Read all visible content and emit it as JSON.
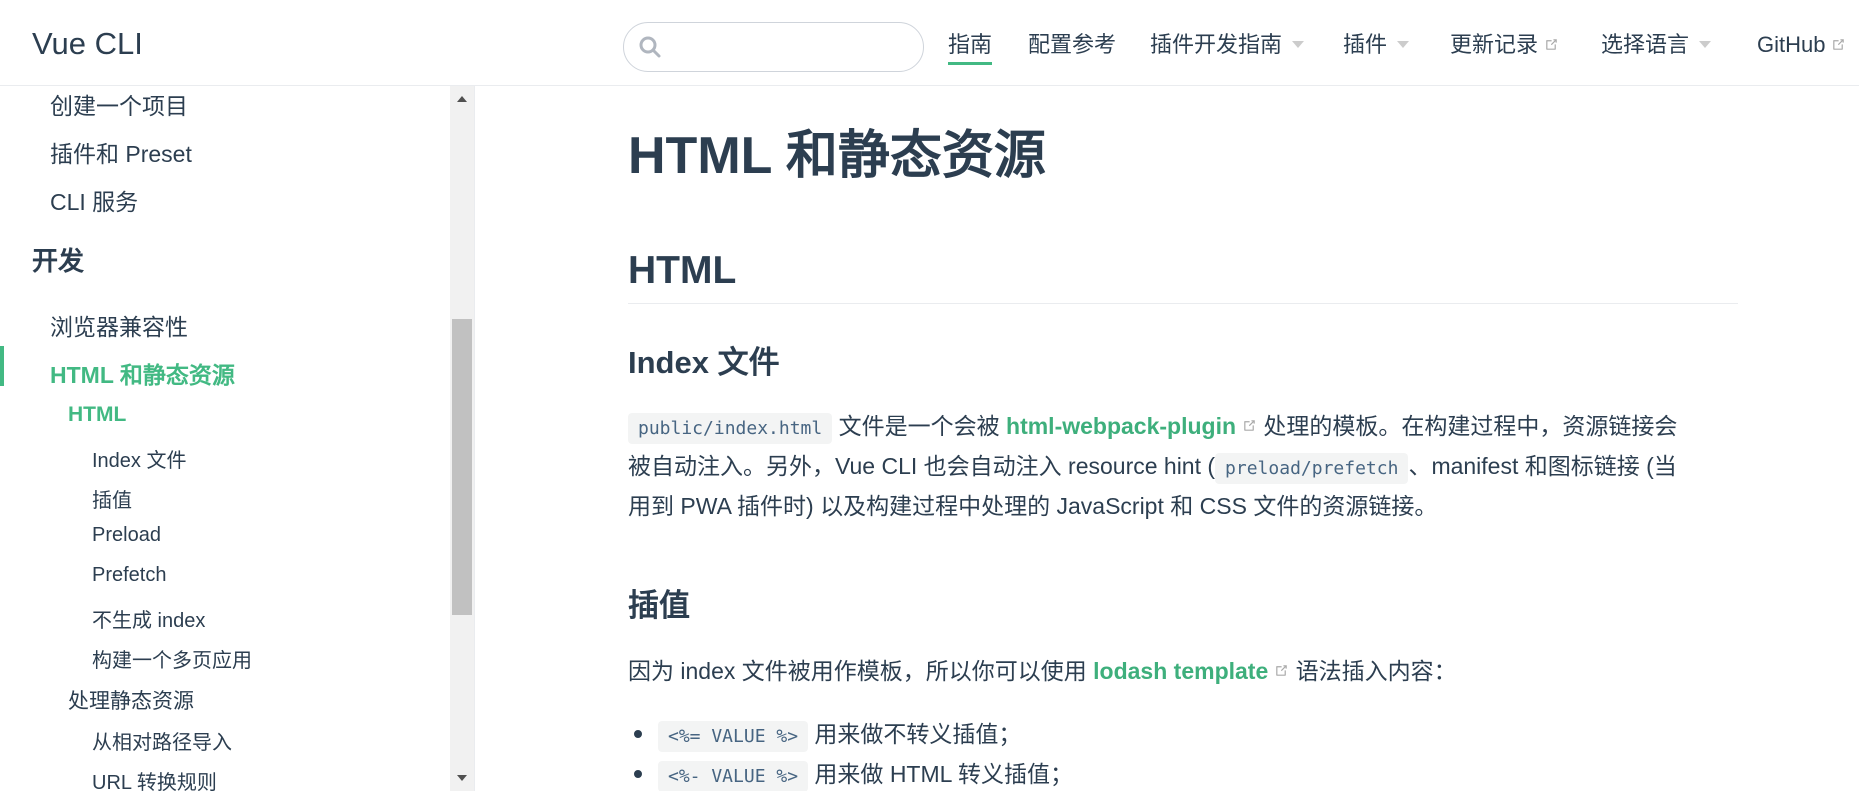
{
  "header": {
    "site_name": "Vue CLI",
    "search": {
      "placeholder": ""
    },
    "nav": [
      {
        "label": "指南",
        "active": true,
        "dropdown": false,
        "external": false
      },
      {
        "label": "配置参考",
        "active": false,
        "dropdown": false,
        "external": false
      },
      {
        "label": "插件开发指南",
        "active": false,
        "dropdown": true,
        "external": false
      },
      {
        "label": "插件",
        "active": false,
        "dropdown": true,
        "external": false
      },
      {
        "label": "更新记录",
        "active": false,
        "dropdown": false,
        "external": true
      },
      {
        "label": "选择语言",
        "active": false,
        "dropdown": true,
        "external": false
      },
      {
        "label": "GitHub",
        "active": false,
        "dropdown": false,
        "external": true
      }
    ]
  },
  "sidebar": {
    "items": [
      {
        "label": "创建一个项目",
        "level": 1
      },
      {
        "label": "插件和 Preset",
        "level": 1
      },
      {
        "label": "CLI 服务",
        "level": 1
      },
      {
        "label": "开发",
        "level": 0
      },
      {
        "label": "浏览器兼容性",
        "level": 1
      },
      {
        "label": "HTML 和静态资源",
        "level": 1,
        "active": true
      },
      {
        "label": "HTML",
        "level": 2,
        "active": true
      },
      {
        "label": "Index 文件",
        "level": 3
      },
      {
        "label": "插值",
        "level": 3
      },
      {
        "label": "Preload",
        "level": 3
      },
      {
        "label": "Prefetch",
        "level": 3
      },
      {
        "label": "不生成 index",
        "level": 3
      },
      {
        "label": "构建一个多页应用",
        "level": 3
      },
      {
        "label": "处理静态资源",
        "level": 2
      },
      {
        "label": "从相对路径导入",
        "level": 3
      },
      {
        "label": "URL 转换规则",
        "level": 3
      }
    ]
  },
  "content": {
    "title": "HTML 和静态资源",
    "section_html": "HTML",
    "index_heading": {
      "prefix": "Index ",
      "strong": "文件"
    },
    "para1": {
      "code1": "public/index.html",
      "t1": " 文件是一个会被 ",
      "link1": "html-webpack-plugin",
      "t2": " 处理的模板。在构建过程中，资源链接会",
      "t3": "被自动注入。另外，Vue CLI 也会自动注入 resource hint (",
      "code2": "preload/prefetch",
      "t4": "、manifest 和图标链接 (当",
      "t5": "用到 PWA 插件时) 以及构建过程中处理的 JavaScript 和 CSS 文件的资源链接。"
    },
    "interp_heading": "插值",
    "para2": {
      "t1": "因为 index 文件被用作模板，所以你可以使用 ",
      "link": "lodash template",
      "t2": " 语法插入内容："
    },
    "bullets": [
      {
        "code": "<%= VALUE %>",
        "text": " 用来做不转义插值；"
      },
      {
        "code": "<%- VALUE %>",
        "text": " 用来做 HTML 转义插值；"
      }
    ]
  },
  "colors": {
    "accent": "#42b983",
    "text": "#2c3e50",
    "code_text": "#476582"
  }
}
